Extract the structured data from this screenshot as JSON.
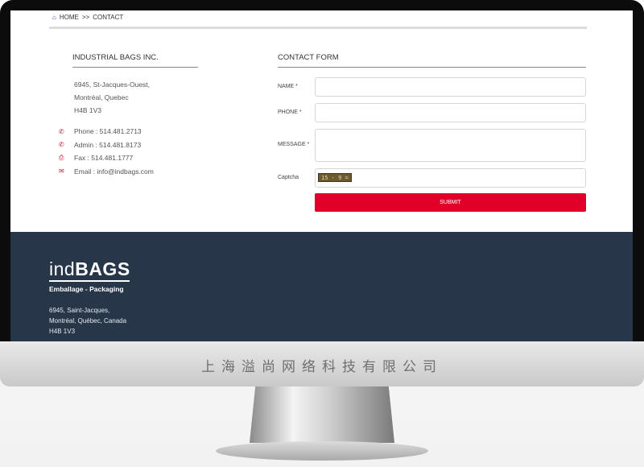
{
  "breadcrumb": {
    "home": "HOME",
    "separator": ">>",
    "current": "CONTACT"
  },
  "company": {
    "name": "INDUSTRIAL BAGS INC.",
    "address": [
      "6945, St-Jacques-Ouest,",
      "Montréal, Quebec",
      "H4B 1V3"
    ],
    "contacts": [
      {
        "icon": "phone-icon",
        "text": "Phone : 514.481.2713"
      },
      {
        "icon": "phone-icon",
        "text": "Admin : 514.481.8173"
      },
      {
        "icon": "fax-icon",
        "text": "Fax : 514.481.1777"
      },
      {
        "icon": "mail-icon",
        "text": "Email : info@indbags.com"
      }
    ]
  },
  "form": {
    "title": "CONTACT FORM",
    "name_label": "NAME *",
    "phone_label": "PHONE *",
    "message_label": "MESSAGE *",
    "captcha_label": "Captcha",
    "captcha_code": "15 - 9 =",
    "submit_label": "SUBMIT",
    "name_value": "",
    "phone_value": "",
    "message_value": "",
    "captcha_value": ""
  },
  "footer": {
    "logo_light": "ind",
    "logo_bold": "BAGS",
    "tagline": "Emballage - Packaging",
    "address": [
      "6945, Saint-Jacques,",
      "Montréal, Québec, Canada",
      "H4B 1V3"
    ]
  },
  "monitor": {
    "brand_text": "上海溢尚网络科技有限公司"
  },
  "colors": {
    "accent": "#e0002a",
    "footer_bg": "#28364a",
    "icon_red": "#c8102e"
  }
}
